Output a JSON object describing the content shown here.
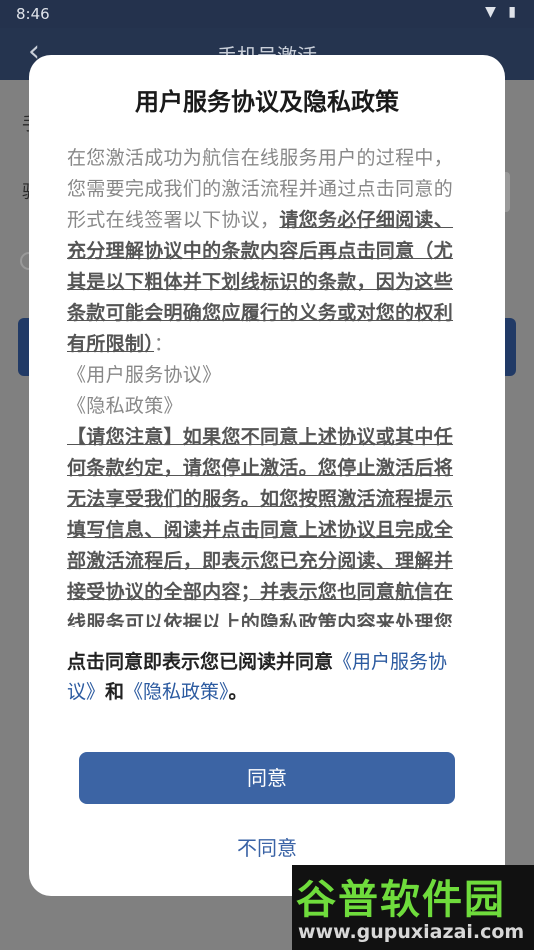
{
  "status_bar": {
    "time": "8:46",
    "icons": "▼ ▮"
  },
  "app_header": {
    "title": "手机号激活",
    "back_icon": "‹"
  },
  "background": {
    "text_a": "手",
    "text_b": "验"
  },
  "dialog": {
    "title": "用户服务协议及隐私政策",
    "intro": "在您激活成功为航信在线服务用户的过程中，您需要完成我们的激活流程并通过点击同意的形式在线签署以下协议，",
    "emphasis1": "请您务必仔细阅读、充分理解协议中的条款内容后再点击同意（尤其是以下粗体并下划线标识的条款，因为这些条款可能会明确您应履行的义务或对您的权利有所限制）",
    "colon": "：",
    "doc1": "《用户服务协议》",
    "doc2": "《隐私政策》",
    "notice": "【请您注意】如果您不同意上述协议或其中任何条款约定，请您停止激活。您停止激活后将无法享受我们的服务。如您按照激活流程提示填写信息、阅读并点击同意上述协议且完成全部激活流程后，即表示您已充分阅读、理解并接受协议的全部内容；并表示您也同意航信在线服务可以依据以上的隐私政策内容来处理您",
    "consent_prefix": "点击同意即表示您已阅读并同意",
    "consent_link1": "《用户服务协议》",
    "consent_and": "和",
    "consent_link2": "《隐私政策》",
    "consent_suffix": "。",
    "agree_label": "同意",
    "disagree_label": "不同意"
  },
  "watermark": {
    "logo": "谷普软件园",
    "url": "www.gupuxiazai.com"
  },
  "colors": {
    "accent": "#3c64a4",
    "link": "#2b5aa0",
    "header": "#25344f"
  }
}
